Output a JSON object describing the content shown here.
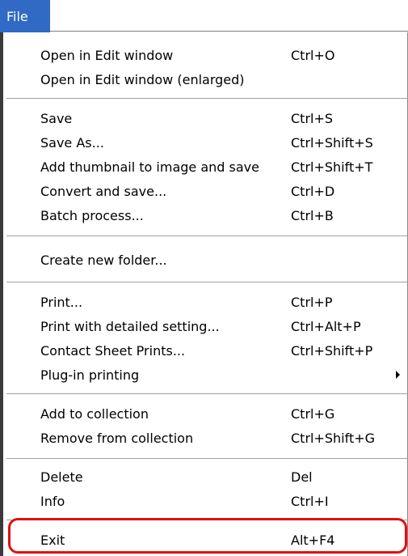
{
  "menubar": {
    "file_label": "File"
  },
  "menu": {
    "groups": [
      [
        {
          "label": "Open in Edit window",
          "shortcut": "Ctrl+O"
        },
        {
          "label": "Open in Edit window (enlarged)",
          "shortcut": ""
        }
      ],
      [
        {
          "label": "Save",
          "shortcut": "Ctrl+S"
        },
        {
          "label": "Save As...",
          "shortcut": "Ctrl+Shift+S"
        },
        {
          "label": "Add thumbnail to image and save",
          "shortcut": "Ctrl+Shift+T"
        },
        {
          "label": "Convert and save...",
          "shortcut": "Ctrl+D"
        },
        {
          "label": "Batch process...",
          "shortcut": "Ctrl+B"
        }
      ],
      [
        {
          "label": "Create new folder...",
          "shortcut": ""
        }
      ],
      [
        {
          "label": "Print...",
          "shortcut": "Ctrl+P"
        },
        {
          "label": "Print with detailed setting...",
          "shortcut": "Ctrl+Alt+P"
        },
        {
          "label": "Contact Sheet Prints...",
          "shortcut": "Ctrl+Shift+P"
        },
        {
          "label": "Plug-in printing",
          "shortcut": "",
          "submenu": true
        }
      ],
      [
        {
          "label": "Add to collection",
          "shortcut": "Ctrl+G"
        },
        {
          "label": "Remove from collection",
          "shortcut": "Ctrl+Shift+G"
        }
      ],
      [
        {
          "label": "Delete",
          "shortcut": "Del"
        },
        {
          "label": "Info",
          "shortcut": "Ctrl+I"
        }
      ],
      [
        {
          "label": "Exit",
          "shortcut": "Alt+F4"
        }
      ]
    ]
  },
  "colors": {
    "file_tab_bg": "#316ac5",
    "highlight_border": "#e01010"
  }
}
